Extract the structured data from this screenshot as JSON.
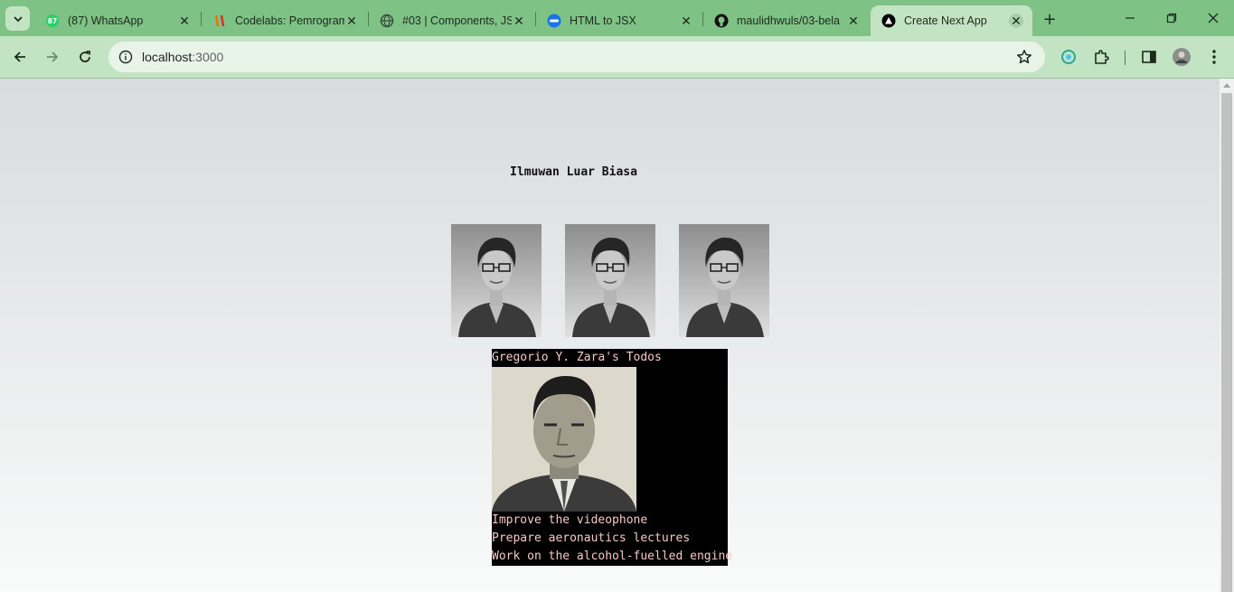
{
  "browser": {
    "tabs": [
      {
        "title": "(87) WhatsApp",
        "icon": "whatsapp-icon",
        "badge": "87"
      },
      {
        "title": "Codelabs: Pemrogram",
        "icon": "codelabs-icon"
      },
      {
        "title": "#03 | Components, JS",
        "icon": "globe-icon"
      },
      {
        "title": "HTML to JSX",
        "icon": "html-to-jsx-icon"
      },
      {
        "title": "maulidhwuls/03-bela",
        "icon": "github-icon"
      },
      {
        "title": "Create Next App",
        "icon": "nextjs-icon"
      }
    ],
    "active_tab": 5,
    "url_host": "localhost",
    "url_port": ":3000"
  },
  "page": {
    "heading": "Ilmuwan Luar Biasa",
    "gallery_count": 3,
    "todo": {
      "title": "Gregorio Y. Zara's Todos",
      "items": [
        "Improve the videophone",
        "Prepare aeronautics lectures",
        "Work on the alcohol-fuelled engine"
      ]
    }
  },
  "colors": {
    "tab_strip": "#7fc286",
    "toolbar": "#c3e4c3",
    "todo_background": "#000000",
    "todo_text": "#f6c7c7"
  }
}
